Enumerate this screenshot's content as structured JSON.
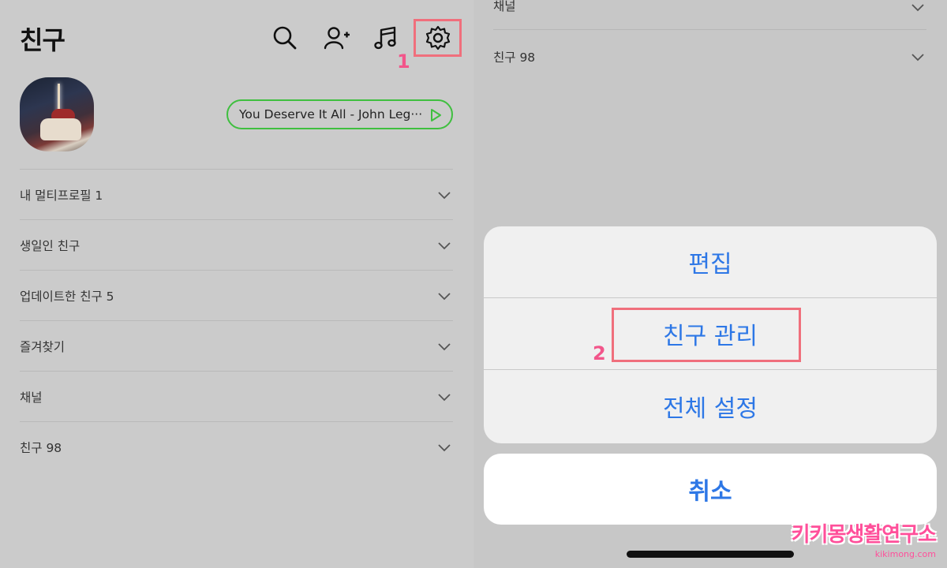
{
  "left": {
    "title": "친구",
    "step_number": "1",
    "music_title": "You Deserve It All - John Leg···",
    "sections": [
      {
        "label": "내 멀티프로필 1"
      },
      {
        "label": "생일인 친구"
      },
      {
        "label": "업데이트한 친구 5"
      },
      {
        "label": "즐겨찾기"
      },
      {
        "label": "채널"
      },
      {
        "label": "친구 98"
      }
    ]
  },
  "right": {
    "sections": [
      {
        "label": "채널"
      },
      {
        "label": "친구 98"
      }
    ],
    "step_number": "2",
    "action_sheet": {
      "items": [
        "편집",
        "친구 관리",
        "전체 설정"
      ],
      "cancel": "취소"
    }
  },
  "watermark": {
    "brand": "키키몽생활연구소",
    "url": "kikimong.com"
  },
  "colors": {
    "highlight": "#f06f7c",
    "step_number": "#f2558a",
    "music_border": "#3fbf3f",
    "sheet_text": "#2d77e6"
  }
}
